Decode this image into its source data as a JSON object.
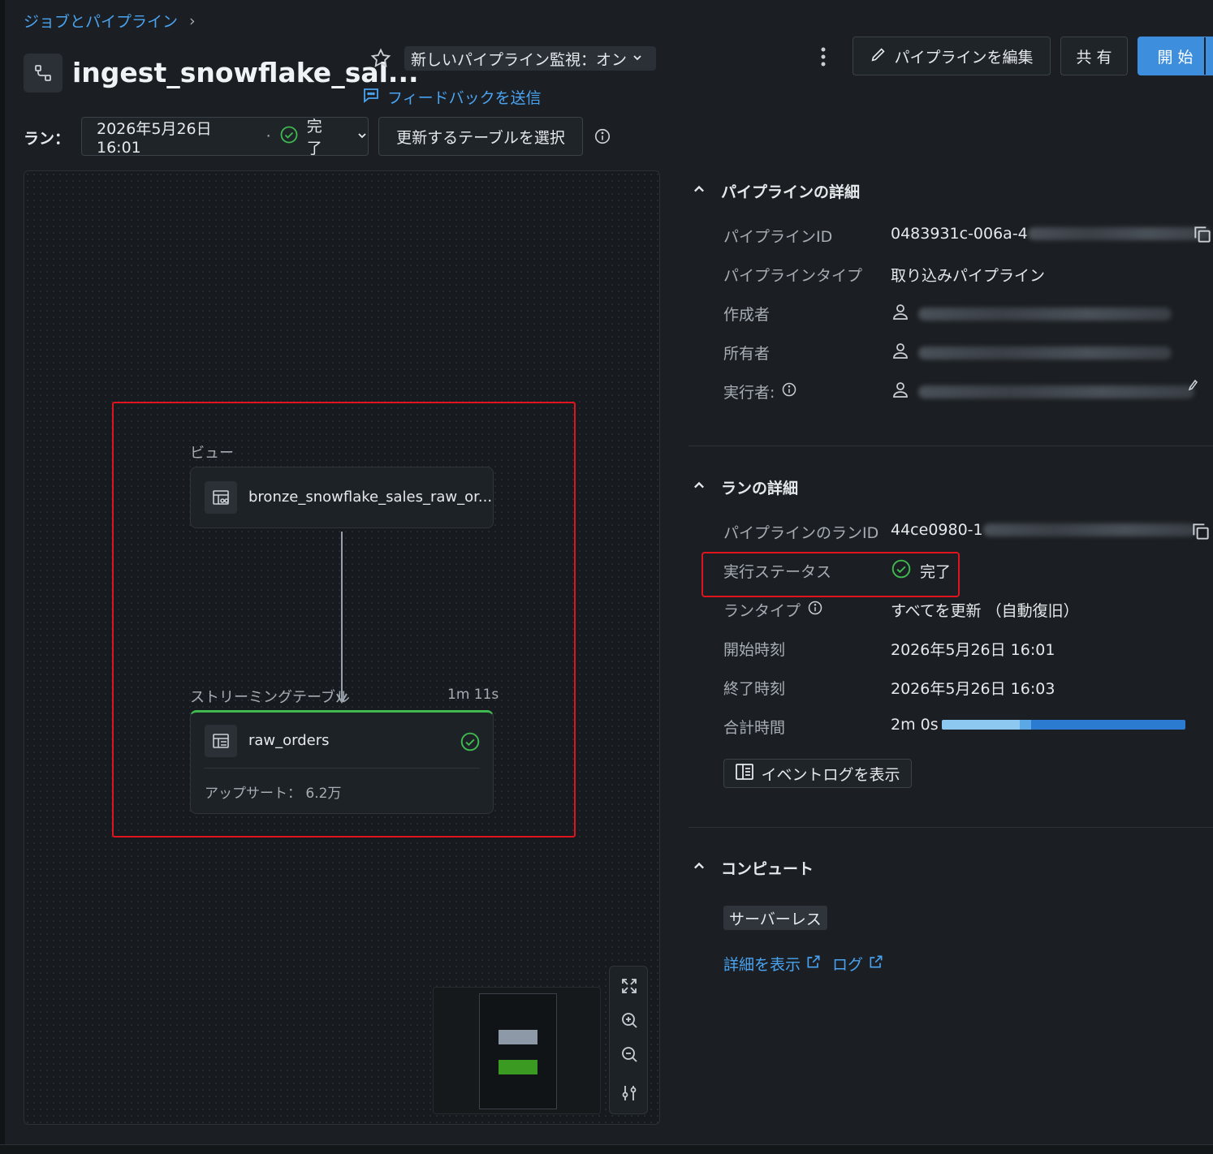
{
  "breadcrumb": {
    "label": "ジョブとパイプライン",
    "separator": "›"
  },
  "header": {
    "title": "ingest_snowflake_sal...",
    "monitor_toggle": "新しいパイプライン監視：オン",
    "feedback_link": "フィードバックを送信",
    "edit_button": "パイプラインを編集",
    "share_button": "共 有",
    "start_button": "開 始"
  },
  "run_bar": {
    "label": "ラン：",
    "run_time": "2026年5月26日 16:01",
    "separator": "·",
    "status": "完了",
    "select_tables_button": "更新するテーブルを選択"
  },
  "graph": {
    "view_section_label": "ビュー",
    "view_node_name": "bronze_snowflake_sales_raw_or...",
    "streaming_section_label": "ストリーミングテーブル",
    "streaming_duration": "1m 11s",
    "table_node_name": "raw_orders",
    "table_node_stat": "アップサート： 6.2万"
  },
  "pipeline_details": {
    "title": "パイプラインの詳細",
    "id_label": "パイプラインID",
    "id_value": "0483931c-006a-4",
    "type_label": "パイプラインタイプ",
    "type_value": "取り込みパイプライン",
    "creator_label": "作成者",
    "owner_label": "所有者",
    "run_as_label": "実行者:"
  },
  "run_details": {
    "title": "ランの詳細",
    "run_id_label": "パイプラインのランID",
    "run_id_value": "44ce0980-1",
    "status_label": "実行ステータス",
    "status_value": "完了",
    "run_type_label": "ランタイプ",
    "run_type_value": "すべてを更新 （自動復旧）",
    "start_label": "開始時刻",
    "start_value": "2026年5月26日 16:01",
    "end_label": "終了時刻",
    "end_value": "2026年5月26日 16:03",
    "total_label": "合計時間",
    "total_value": "2m 0s",
    "event_log_button": "イベントログを表示"
  },
  "compute": {
    "title": "コンピュート",
    "badge": "サーバーレス",
    "details_link": "詳細を表示",
    "log_link": "ログ"
  },
  "colors": {
    "accent_blue": "#3d8fdd",
    "link_blue": "#4aa3f0",
    "success_green": "#3fb950",
    "highlight_red": "#e0141e"
  }
}
